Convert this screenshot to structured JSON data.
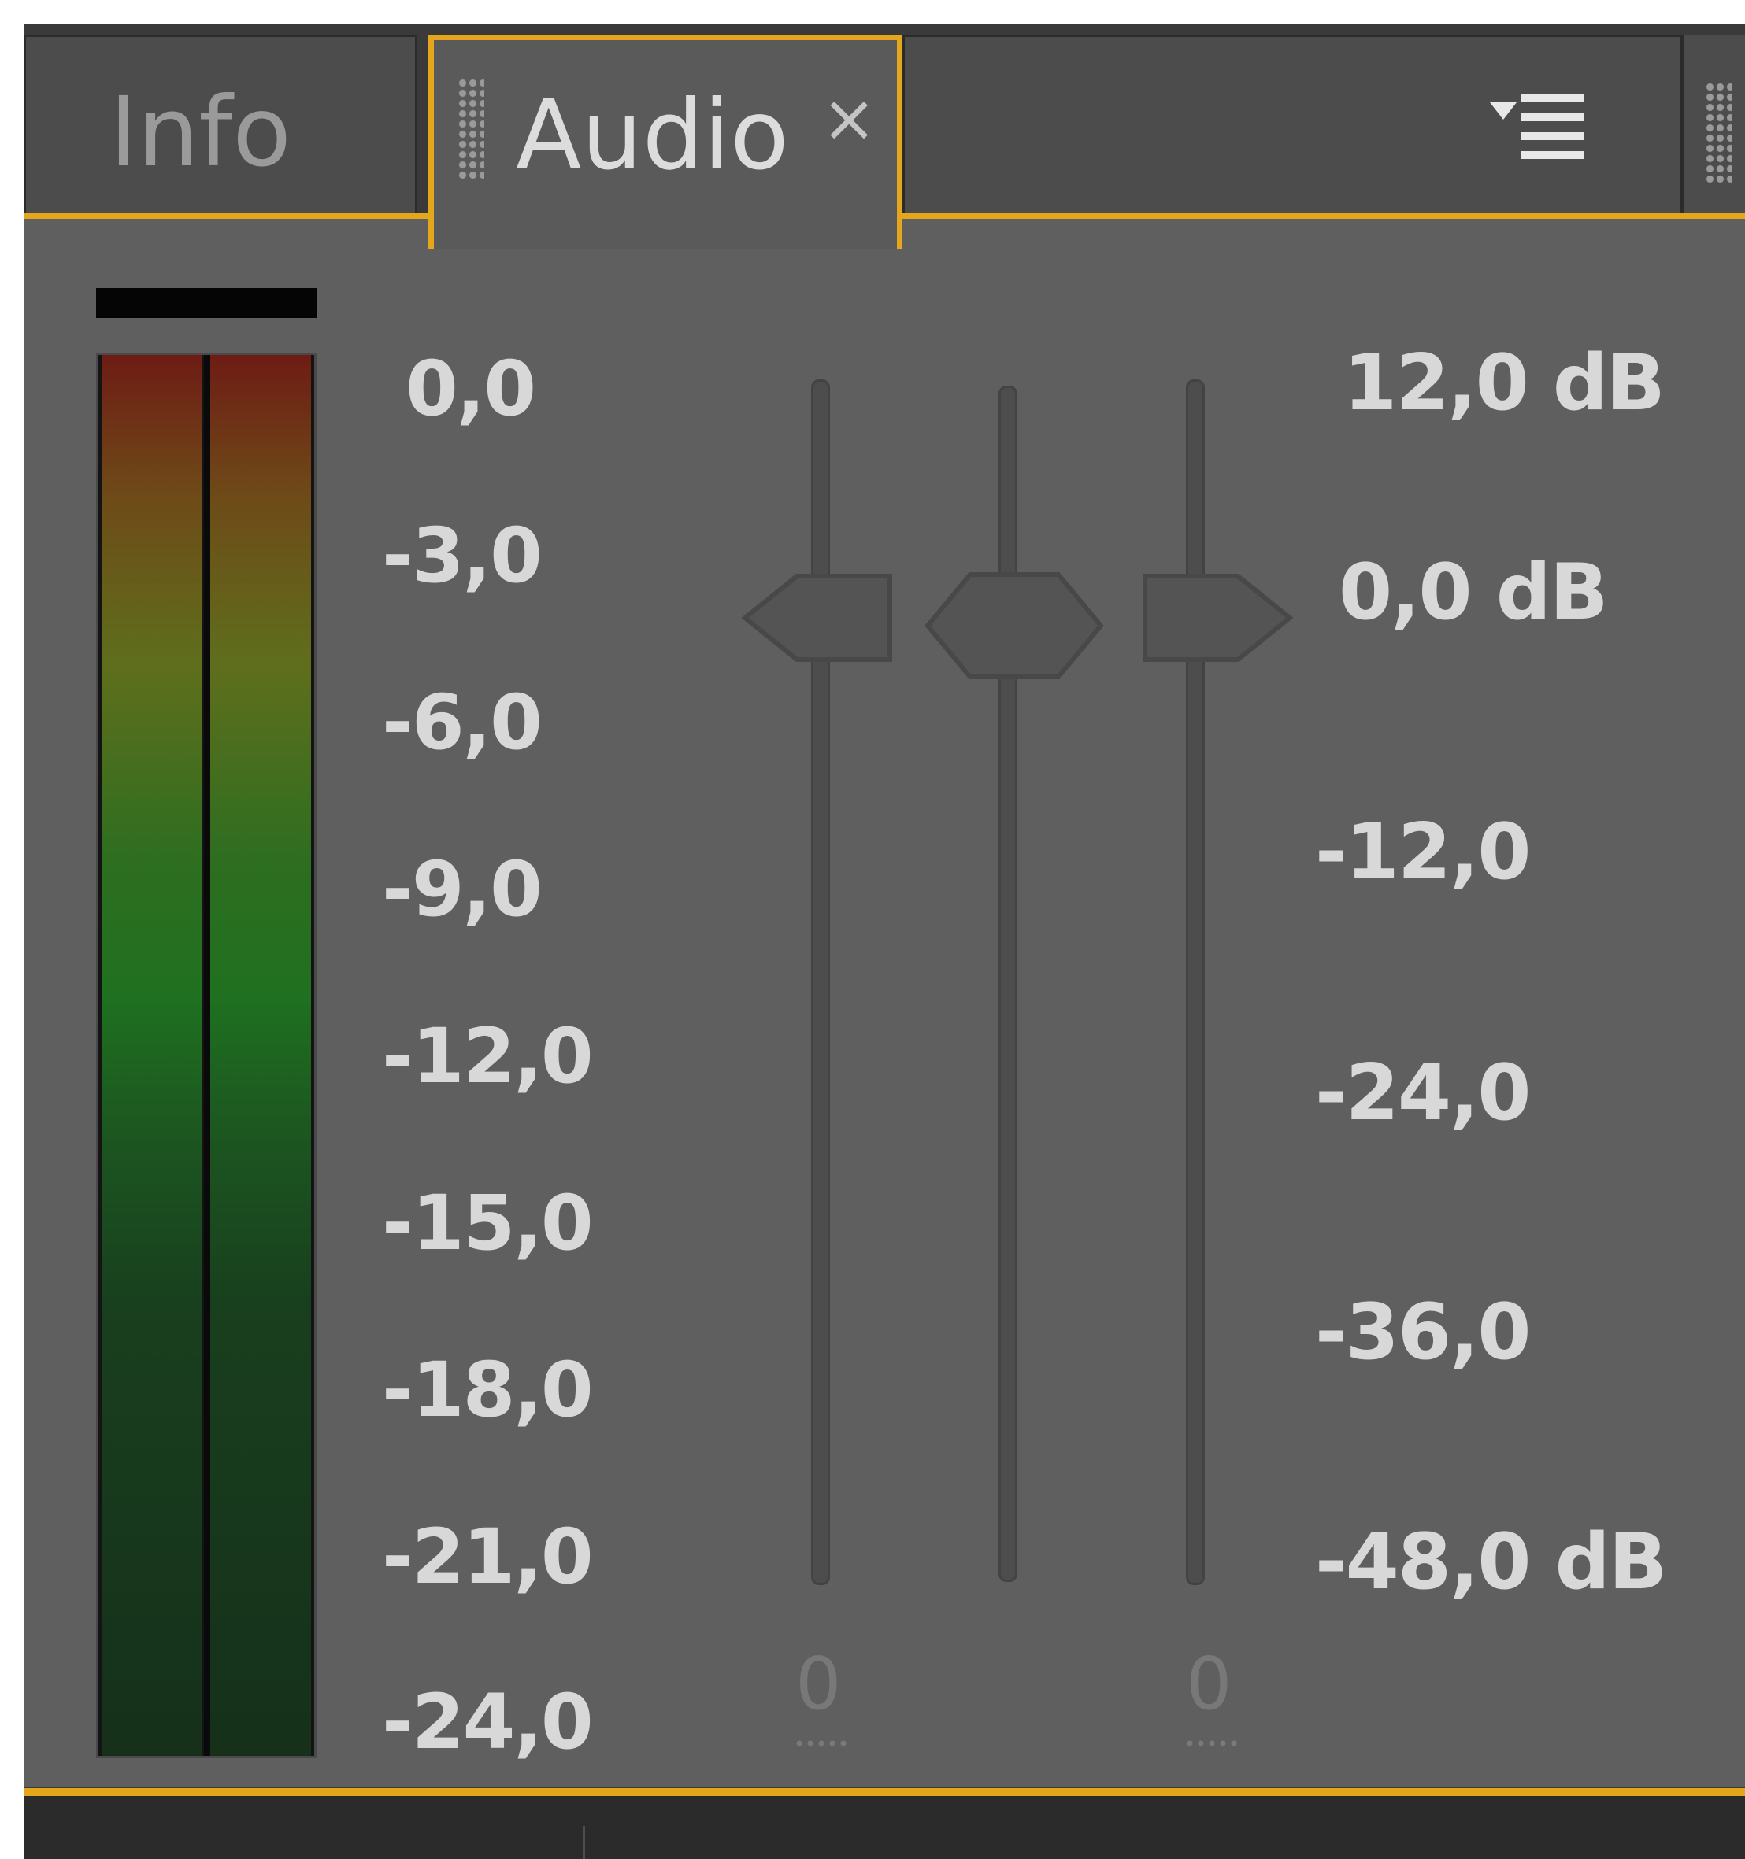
{
  "tabs": [
    {
      "label": "Info"
    },
    {
      "label": "Audio",
      "close": "×"
    }
  ],
  "colors": {
    "active_accent": "#e4a61c",
    "panel_bg": "#5f5f5f",
    "tab_bg": "#4c4c4c",
    "meter_top": "#6e1c14",
    "meter_mid": "#1f7020",
    "meter_bottom": "#16301a"
  },
  "icons": {
    "tab_grip": "grip-icon",
    "close": "close-icon",
    "panel_menu": "panel-menu-icon"
  },
  "meter": {
    "scale": [
      "0,0",
      "-3,0",
      "-6,0",
      "-9,0",
      "-12,0",
      "-15,0",
      "-18,0",
      "-21,0",
      "-24,0"
    ],
    "left_level_db": 0.0,
    "right_level_db": 0.0
  },
  "fader_scale": [
    "12,0 dB",
    "0,0 dB",
    "-12,0",
    "-24,0",
    "-36,0",
    "-48,0 dB"
  ],
  "faders": {
    "left_balance": {
      "value_label": "0"
    },
    "master_volume_db": 0.0,
    "right_balance": {
      "value_label": "0"
    }
  }
}
